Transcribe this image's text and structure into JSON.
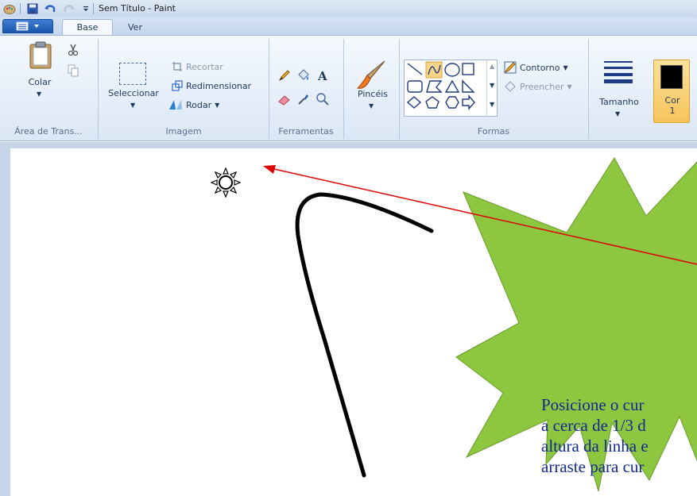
{
  "window": {
    "title": "Sem Título - Paint"
  },
  "tabs": [
    {
      "label": "Base"
    },
    {
      "label": "Ver"
    }
  ],
  "ribbon": {
    "clipboard": {
      "paste_label": "Colar",
      "group_label": "Área de Trans..."
    },
    "image": {
      "select_label": "Seleccionar",
      "crop_label": "Recortar",
      "resize_label": "Redimensionar",
      "rotate_label": "Rodar",
      "group_label": "Imagem"
    },
    "tools": {
      "group_label": "Ferramentas"
    },
    "brushes": {
      "label": "Pincéis"
    },
    "shapes": {
      "outline_label": "Contorno",
      "fill_label": "Preencher",
      "group_label": "Formas"
    },
    "size": {
      "label": "Tamanho"
    },
    "color1": {
      "label_line1": "Cor",
      "label_line2": "1",
      "value": "#000000"
    }
  },
  "canvas": {
    "callout": {
      "lines": [
        "Posicione o cur",
        "a cerca de 1/3 d",
        "altura da linha e",
        "arraste para cur"
      ],
      "fill": "#8dc63f",
      "text_color": "#102a90"
    },
    "arrow_color": "#e00000",
    "stroke_color": "#000000"
  },
  "colors": {
    "ribbon_bg": "#e5eef9",
    "titlebar_bg": "#d3e1f2",
    "canvas_bg": "#c5d4e8",
    "color1_highlight": "#f6c35a"
  }
}
